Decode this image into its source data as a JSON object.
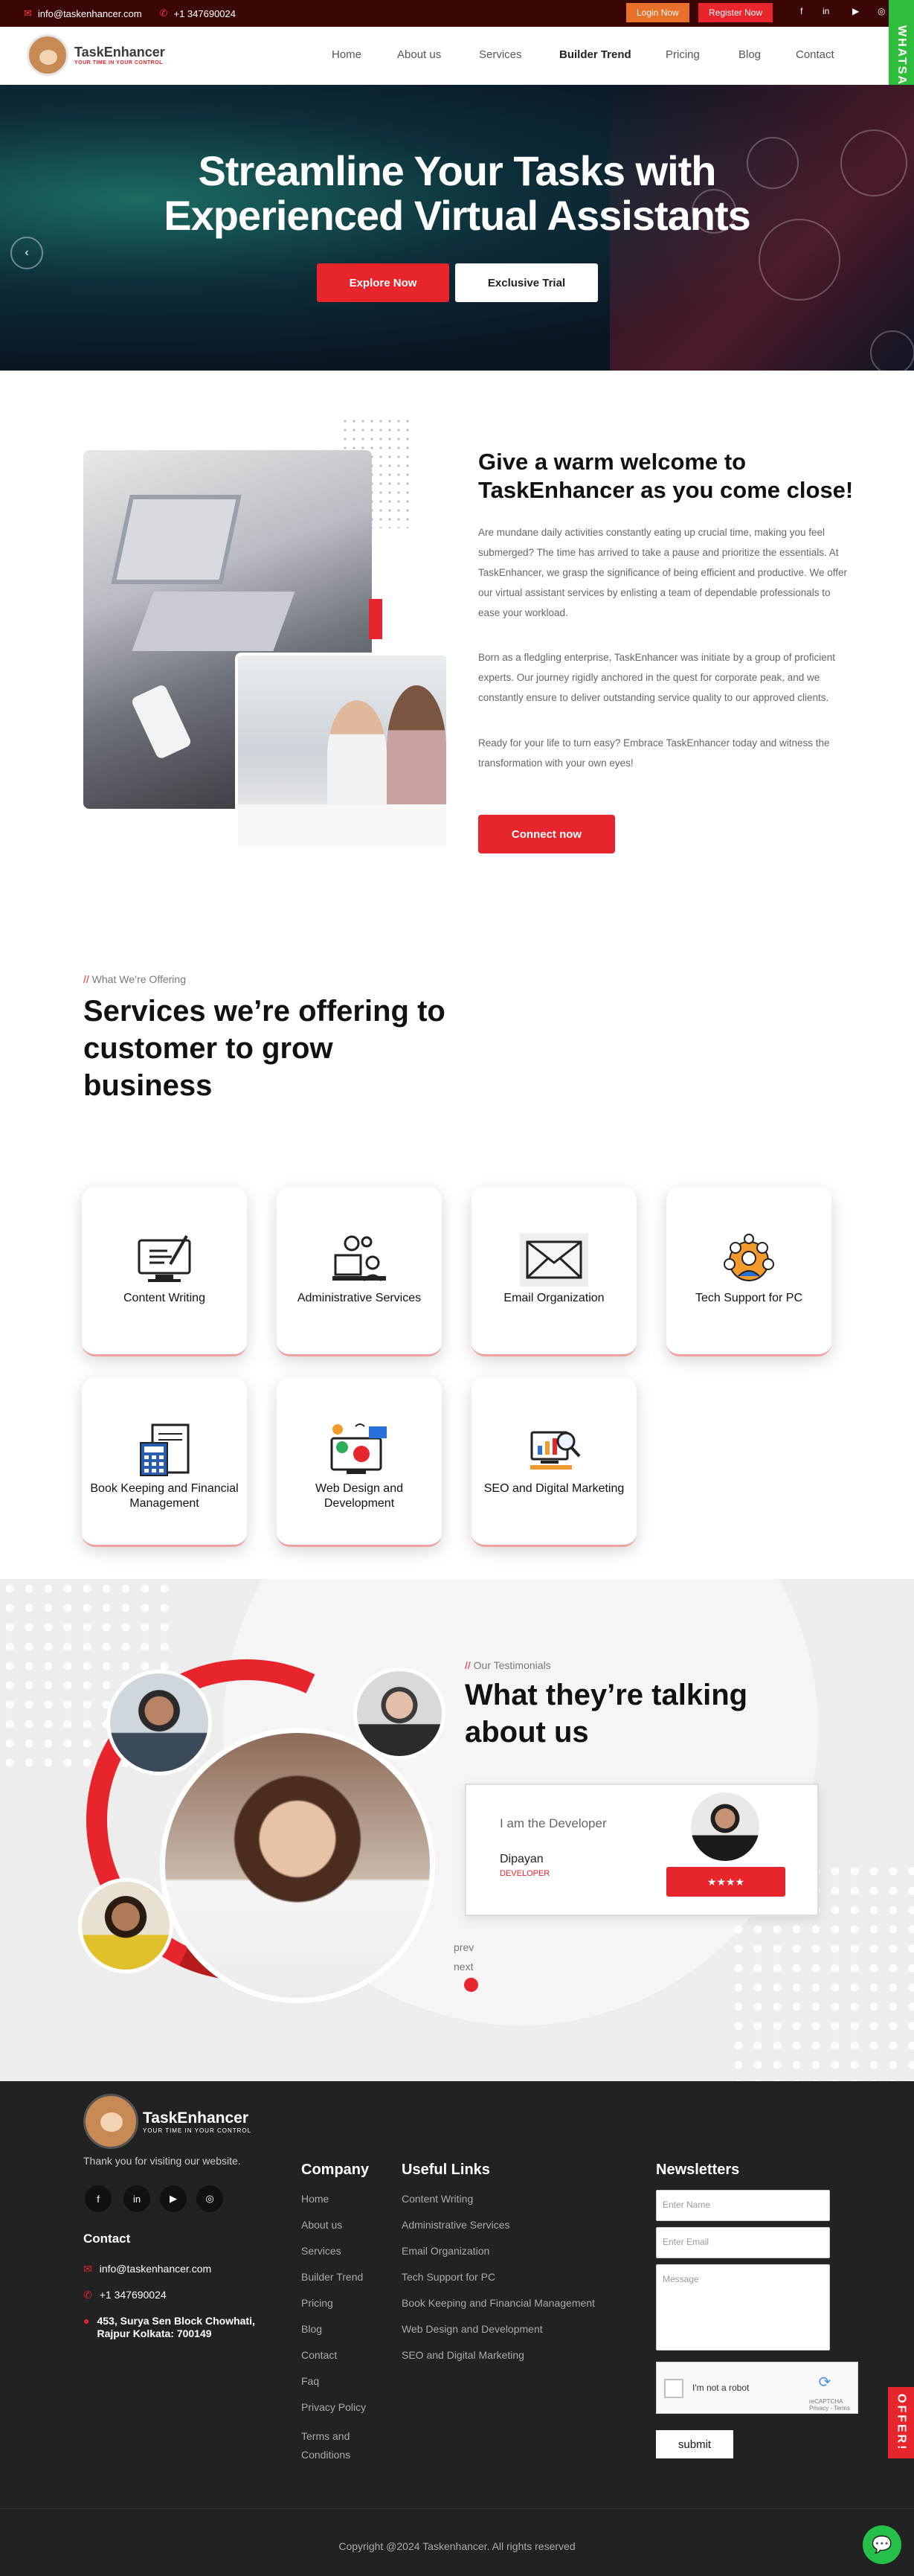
{
  "topbar": {
    "email": "info@taskenhancer.com",
    "phone": "+1 347690024",
    "login": "Login Now",
    "register": "Register Now"
  },
  "brand": {
    "name": "TaskEnhancer",
    "tagline": "YOUR TIME IN YOUR CONTROL"
  },
  "nav": [
    "Home",
    "About us",
    "Services",
    "Builder Trend",
    "Pricing",
    "Blog",
    "Contact"
  ],
  "whatsapp": "WHATSAPP",
  "hero": {
    "line1": "Streamline Your Tasks with",
    "line2": "Experienced Virtual Assistants",
    "btn1": "Explore Now",
    "btn2": "Exclusive Trial"
  },
  "about": {
    "heading": "Give a warm welcome to TaskEnhancer as you come close!",
    "p1": "Are mundane daily activities constantly eating up crucial time, making you feel submerged? The time has arrived to take a pause and prioritize the essentials. At TaskEnhancer, we grasp the significance of being efficient and productive. We offer our virtual assistant services by enlisting a team of dependable professionals to ease your workload.",
    "p2": "Born as a fledgling enterprise, TaskEnhancer was initiate by a group of proficient experts. Our journey rigidly anchored in the quest for corporate peak, and we constantly ensure to deliver outstanding service quality to our approved clients.",
    "p3": "Ready for your life to turn easy? Embrace TaskEnhancer today and witness the transformation with your own eyes!",
    "button": "Connect now"
  },
  "services": {
    "kicker_slash": "//",
    "kicker": "What We’re Offering",
    "heading": "Services we’re offering to customer to grow business",
    "items": [
      {
        "label": "Content Writing",
        "icon": "content-writing-icon"
      },
      {
        "label": "Administrative Services",
        "icon": "administrative-services-icon"
      },
      {
        "label": "Email Organization",
        "icon": "email-icon"
      },
      {
        "label": "Tech Support for PC",
        "icon": "tech-support-icon"
      },
      {
        "label": "Book Keeping and Financial Management",
        "icon": "bookkeeping-icon"
      },
      {
        "label": "Web Design and Development",
        "icon": "web-design-icon"
      },
      {
        "label": "SEO and Digital Marketing",
        "icon": "seo-icon"
      }
    ]
  },
  "testimonials": {
    "kicker_slash": "//",
    "kicker": "Our Testimonials",
    "heading": "What they’re talking about us",
    "quote": "I am the Developer",
    "name": "Dipayan",
    "role": "DEVELOPER",
    "stars": "★★★★",
    "prev": "prev",
    "next": "next"
  },
  "footer": {
    "thanks": "Thank you for visiting our website.",
    "contact_heading": "Contact",
    "email": "info@taskenhancer.com",
    "phone": "+1 347690024",
    "address": "453, Surya Sen Block Chowhati, Rajpur Kolkata: 700149",
    "company_heading": "Company",
    "company_links": [
      "Home",
      "About us",
      "Services",
      "Builder Trend",
      "Pricing",
      "Blog",
      "Contact",
      "Faq",
      "Privacy Policy",
      "Terms and Conditions"
    ],
    "useful_heading": "Useful Links",
    "useful_links": [
      "Content Writing",
      "Administrative Services",
      "Email Organization",
      "Tech Support for PC",
      "Book Keeping and Financial Management",
      "Web Design and Development",
      "SEO and Digital Marketing"
    ],
    "news_heading": "Newsletters",
    "name_ph": "Enter Name",
    "email_ph": "Enter Email",
    "message_ph": "Message",
    "captcha": "I'm not a robot",
    "captcha_small": "reCAPTCHA Privacy - Terms",
    "submit": "submit",
    "copyright": "Copyright @2024 Taskenhancer. All rights reserved"
  },
  "offer": "OFFER!",
  "colors": {
    "accent": "#e8242c",
    "dark": "#222222",
    "topbar": "#3a0606",
    "whatsapp": "#2fbe3c"
  }
}
